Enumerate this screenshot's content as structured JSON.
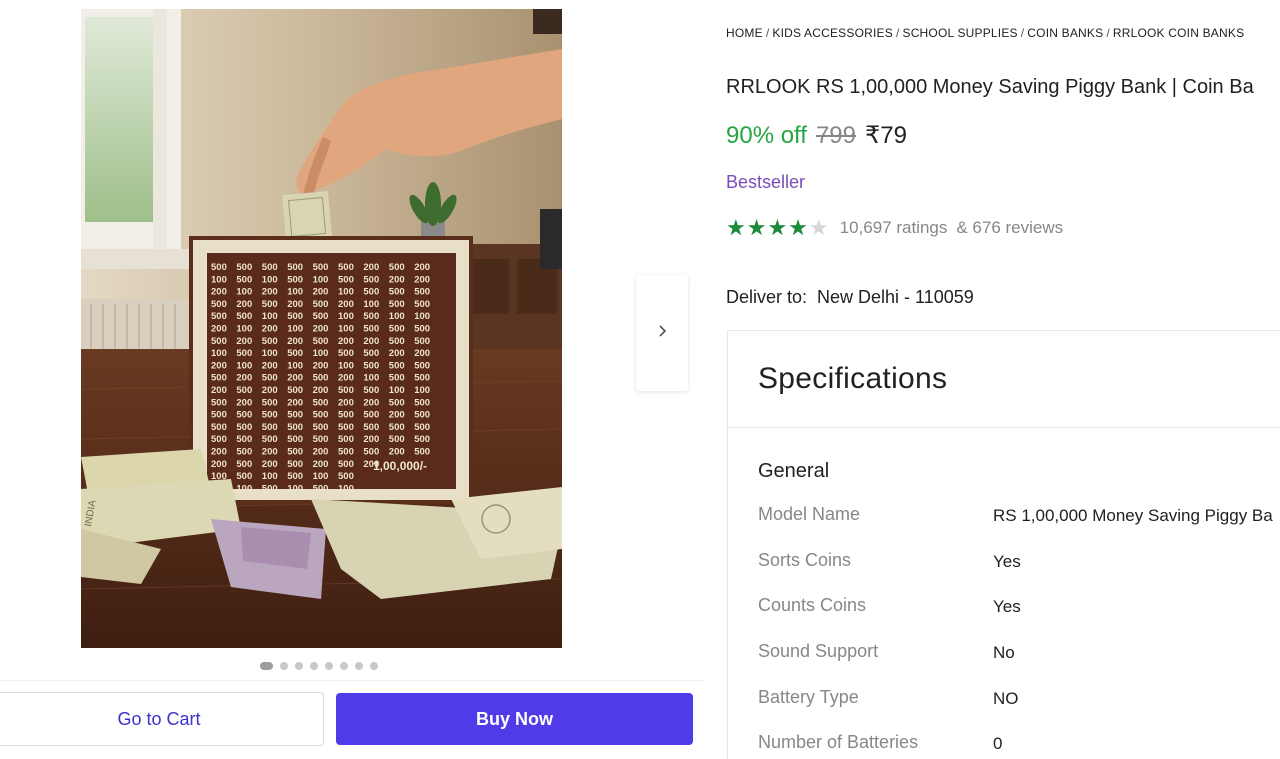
{
  "breadcrumb": [
    "HOME",
    "KIDS ACCESSORIES",
    "SCHOOL SUPPLIES",
    "COIN BANKS",
    "RRLOOK COIN BANKS"
  ],
  "breadcrumb_sep": "/",
  "product": {
    "title": "RRLOOK RS 1,00,000 Money Saving Piggy Bank | Coin Ba",
    "discount": "90% off",
    "mrp": "799",
    "price": "₹79",
    "badge": "Bestseller",
    "rating_fraction": 0.8,
    "ratings": "10,697 ratings",
    "reviews": "& 676 reviews",
    "image": {
      "grid_rows": [
        [
          "500",
          "500",
          "500",
          "500",
          "500",
          "500",
          "200",
          "500",
          "200"
        ],
        [
          "100",
          "500",
          "100",
          "500",
          "100",
          "500",
          "500",
          "200",
          "200"
        ],
        [
          "200",
          "100",
          "200",
          "100",
          "200",
          "100",
          "500",
          "500",
          "500"
        ],
        [
          "500",
          "200",
          "500",
          "200",
          "500",
          "200",
          "100",
          "500",
          "500"
        ],
        [
          "500",
          "500",
          "100",
          "500",
          "500",
          "100",
          "500",
          "100",
          "100"
        ],
        [
          "200",
          "100",
          "200",
          "100",
          "200",
          "100",
          "500",
          "500",
          "500"
        ],
        [
          "500",
          "200",
          "500",
          "200",
          "500",
          "200",
          "200",
          "500",
          "500"
        ],
        [
          "100",
          "500",
          "100",
          "500",
          "100",
          "500",
          "500",
          "200",
          "200"
        ],
        [
          "200",
          "100",
          "200",
          "100",
          "200",
          "100",
          "500",
          "500",
          "500"
        ],
        [
          "500",
          "200",
          "500",
          "200",
          "500",
          "200",
          "100",
          "500",
          "500"
        ],
        [
          "200",
          "500",
          "200",
          "500",
          "200",
          "500",
          "500",
          "100",
          "100"
        ],
        [
          "500",
          "200",
          "500",
          "200",
          "500",
          "200",
          "200",
          "500",
          "500"
        ],
        [
          "500",
          "500",
          "500",
          "500",
          "500",
          "500",
          "500",
          "200",
          "500"
        ],
        [
          "500",
          "500",
          "500",
          "500",
          "500",
          "500",
          "500",
          "500",
          "500"
        ],
        [
          "500",
          "500",
          "500",
          "500",
          "500",
          "500",
          "200",
          "500",
          "500"
        ],
        [
          "200",
          "500",
          "200",
          "500",
          "200",
          "500",
          "500",
          "200",
          "500"
        ],
        [
          "200",
          "500",
          "200",
          "500",
          "200",
          "500",
          "200",
          "",
          ""
        ],
        [
          "100",
          "500",
          "100",
          "500",
          "100",
          "500",
          "",
          "",
          ""
        ],
        [
          "500",
          "100",
          "500",
          "100",
          "500",
          "100",
          "",
          "",
          ""
        ]
      ],
      "board_total": "1,00,000/-",
      "note_text": "INDIA"
    }
  },
  "navigation": {
    "next_icon": "chevron-right-icon",
    "carousel_count": 8,
    "carousel_active": 0
  },
  "delivery": {
    "label": "Deliver to:",
    "location": "New Delhi - 110059"
  },
  "actions": {
    "cart_label": "Go to Cart",
    "buy_label": "Buy Now"
  },
  "specifications": {
    "heading": "Specifications",
    "group": "General",
    "rows": [
      {
        "key": "Model Name",
        "value": "RS 1,00,000 Money Saving Piggy Ba"
      },
      {
        "key": "Sorts Coins",
        "value": "Yes"
      },
      {
        "key": "Counts Coins",
        "value": "Yes"
      },
      {
        "key": "Sound Support",
        "value": "No"
      },
      {
        "key": "Battery Type",
        "value": "NO"
      },
      {
        "key": "Number of Batteries",
        "value": "0"
      }
    ]
  },
  "colors": {
    "accent": "#4f3be8",
    "discount": "#26a541",
    "star": "#1d8b3a",
    "bestseller": "#7b4db8"
  }
}
